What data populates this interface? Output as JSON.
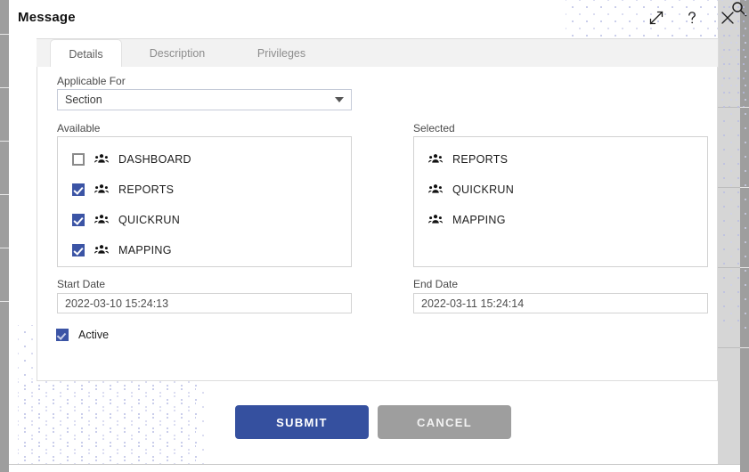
{
  "window": {
    "title": "Message",
    "actions": [
      {
        "name": "expand-icon",
        "label": "Expand"
      },
      {
        "name": "help-icon",
        "label": "Help"
      },
      {
        "name": "close-icon",
        "label": "Close"
      }
    ],
    "corner_icon": "search-icon"
  },
  "tabs": [
    {
      "label": "Details",
      "active": true
    },
    {
      "label": "Description",
      "active": false
    },
    {
      "label": "Privileges",
      "active": false
    }
  ],
  "form": {
    "applicable_for": {
      "label": "Applicable For",
      "value": "Section",
      "caret": "chevron-down-icon"
    },
    "available": {
      "label": "Available",
      "items": [
        {
          "label": "DASHBOARD",
          "checked": false,
          "icon": "group-icon"
        },
        {
          "label": "REPORTS",
          "checked": true,
          "icon": "group-icon"
        },
        {
          "label": "QUICKRUN",
          "checked": true,
          "icon": "group-icon"
        },
        {
          "label": "MAPPING",
          "checked": true,
          "icon": "group-icon"
        }
      ]
    },
    "selected": {
      "label": "Selected",
      "items": [
        {
          "label": "REPORTS",
          "icon": "group-icon"
        },
        {
          "label": "QUICKRUN",
          "icon": "group-icon"
        },
        {
          "label": "MAPPING",
          "icon": "group-icon"
        }
      ]
    },
    "start_date": {
      "label": "Start Date",
      "value": "2022-03-10 15:24:13"
    },
    "end_date": {
      "label": "End Date",
      "value": "2022-03-11 15:24:14"
    },
    "active": {
      "label": "Active",
      "checked": true
    }
  },
  "footer": {
    "submit_label": "SUBMIT",
    "cancel_label": "CANCEL"
  },
  "colors": {
    "accent_blue": "#35509f",
    "checkbox_blue": "#3b54a5",
    "cancel_gray": "#9e9e9e",
    "dot_pattern": "#b9bde4"
  }
}
